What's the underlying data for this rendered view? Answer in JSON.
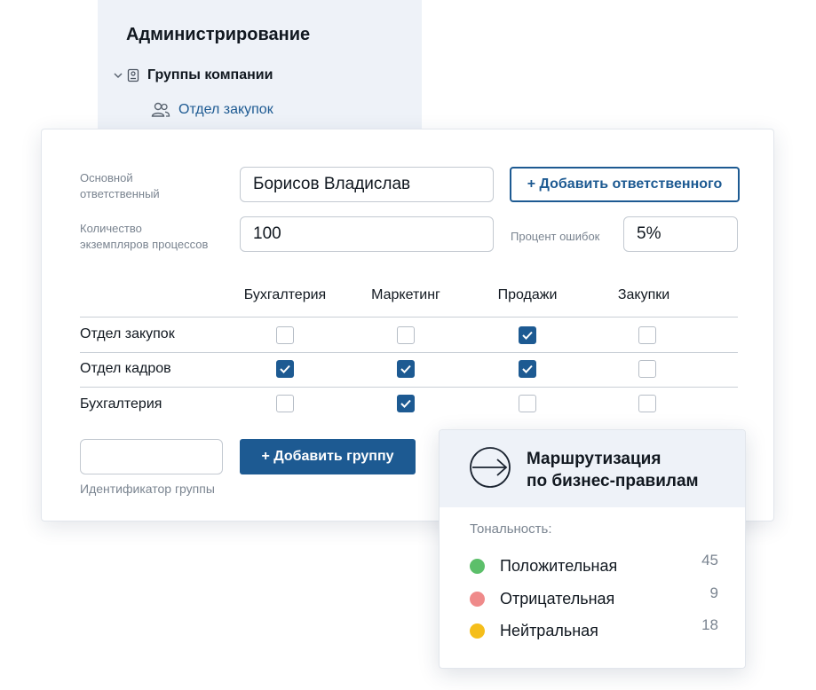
{
  "admin": {
    "title": "Администрирование",
    "tree": {
      "group_label": "Группы компании",
      "child_label": "Отдел закупок"
    }
  },
  "form": {
    "responsible_label": "Основной\nответственный",
    "responsible_value": "Борисов Владислав",
    "add_responsible_button": "+ Добавить ответственного",
    "instances_label": "Количество\nэкземпляров процессов",
    "instances_value": "100",
    "error_percent_label": "Процент ошибок",
    "error_percent_value": "5%"
  },
  "matrix": {
    "columns": [
      "Бухгалтерия",
      "Маркетинг",
      "Продажи",
      "Закупки"
    ],
    "rows": [
      {
        "name": "Отдел закупок",
        "checks": [
          false,
          false,
          true,
          false
        ]
      },
      {
        "name": "Отдел кадров",
        "checks": [
          true,
          true,
          true,
          false
        ]
      },
      {
        "name": "Бухгалтерия",
        "checks": [
          false,
          true,
          false,
          false
        ]
      }
    ]
  },
  "group": {
    "id_value": "",
    "id_label": "Идентификатор группы",
    "add_group_button": "+ Добавить группу"
  },
  "routing": {
    "title_line1": "Маршрутизация",
    "title_line2": "по бизнес-правилам",
    "icon": "arrow-circle-icon",
    "tone_label": "Тональность:",
    "tones": [
      {
        "name": "Положительная",
        "count": "45",
        "color": "#5cbf6a"
      },
      {
        "name": "Отрицательная",
        "count": "9",
        "color": "#ef8a8a"
      },
      {
        "name": "Нейтральная",
        "count": "18",
        "color": "#f5be1b"
      }
    ]
  },
  "colors": {
    "accent": "#1d5a92",
    "panel_bg": "#eef2f8"
  }
}
